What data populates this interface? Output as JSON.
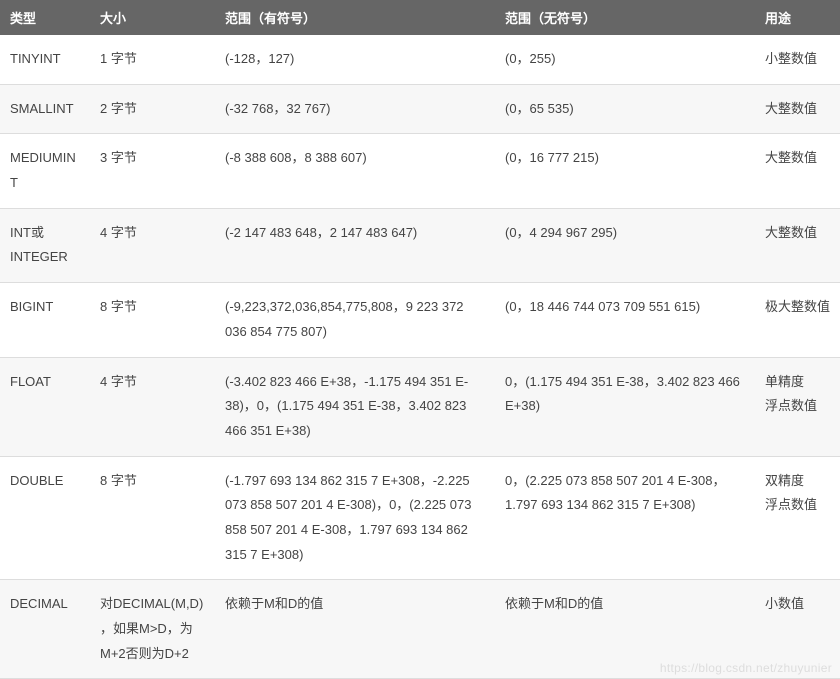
{
  "headers": [
    "类型",
    "大小",
    "范围（有符号）",
    "范围（无符号）",
    "用途"
  ],
  "rows": [
    {
      "type": "TINYINT",
      "size": "1 字节",
      "signed": "(-128，127)",
      "unsigned": "(0，255)",
      "use": "小整数值"
    },
    {
      "type": "SMALLINT",
      "size": "2 字节",
      "signed": "(-32 768，32 767)",
      "unsigned": "(0，65 535)",
      "use": "大整数值"
    },
    {
      "type": "MEDIUMINT",
      "size": "3 字节",
      "signed": "(-8 388 608，8 388 607)",
      "unsigned": "(0，16 777 215)",
      "use": "大整数值"
    },
    {
      "type": "INT或INTEGER",
      "size": "4 字节",
      "signed": "(-2 147 483 648，2 147 483 647)",
      "unsigned": "(0，4 294 967 295)",
      "use": "大整数值"
    },
    {
      "type": "BIGINT",
      "size": "8 字节",
      "signed": "(-9,223,372,036,854,775,808，9 223 372 036 854 775 807)",
      "unsigned": "(0，18 446 744 073 709 551 615)",
      "use": "极大整数值"
    },
    {
      "type": "FLOAT",
      "size": "4 字节",
      "signed": "(-3.402 823 466 E+38，-1.175 494 351 E-38)，0，(1.175 494 351 E-38，3.402 823 466 351 E+38)",
      "unsigned": "0，(1.175 494 351 E-38，3.402 823 466 E+38)",
      "use": "单精度\n浮点数值"
    },
    {
      "type": "DOUBLE",
      "size": "8 字节",
      "signed": "(-1.797 693 134 862 315 7 E+308，-2.225 073 858 507 201 4 E-308)，0，(2.225 073 858 507 201 4 E-308，1.797 693 134 862 315 7 E+308)",
      "unsigned": "0，(2.225 073 858 507 201 4 E-308，1.797 693 134 862 315 7 E+308)",
      "use": "双精度\n浮点数值"
    },
    {
      "type": "DECIMAL",
      "size": "对DECIMAL(M,D) ，如果M>D，为M+2否则为D+2",
      "signed": "依赖于M和D的值",
      "unsigned": "依赖于M和D的值",
      "use": "小数值"
    }
  ],
  "watermark": "https://blog.csdn.net/zhuyunier"
}
